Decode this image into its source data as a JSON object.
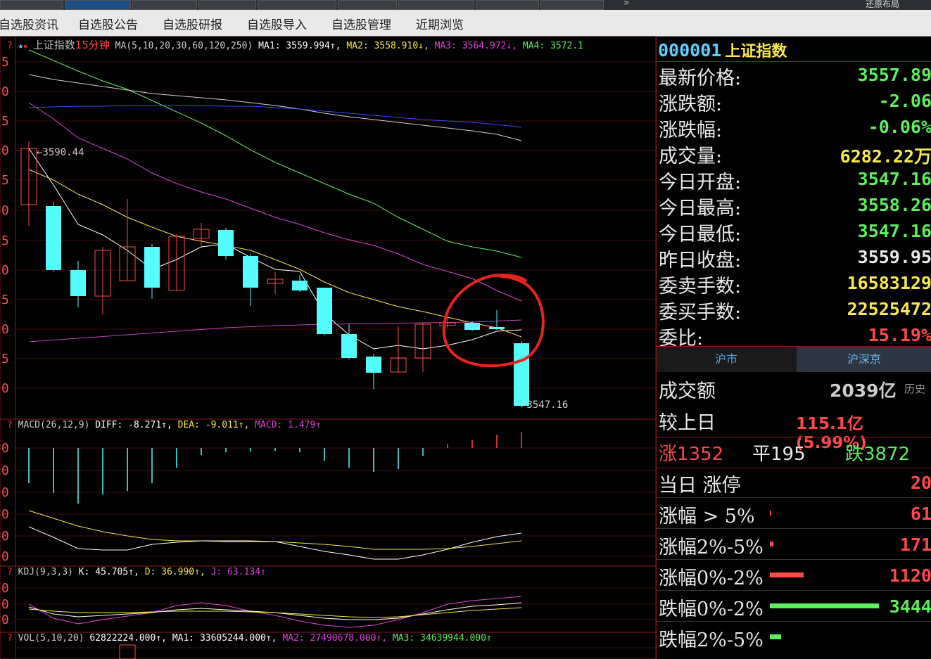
{
  "topbar": {
    "right_label": "还原布局"
  },
  "nav": [
    "自选股资讯",
    "自选股公告",
    "自选股研报",
    "自选股导入",
    "自选股管理",
    "近期浏览"
  ],
  "main_chart": {
    "title": "上证指数",
    "period": "15分钟",
    "ma_params": "MA(5,10,20,30,60,120,250)",
    "ma1": "MA1: 3559.994↑,",
    "ma2": "MA2: 3558.910↓,",
    "ma3": "MA3: 3564.972↓,",
    "ma4": "MA4: 3572.1",
    "high_label": "←3590.44",
    "low_label": "←3547.16",
    "axis_labels": [
      "5",
      "0",
      "5",
      "0",
      "5",
      "0",
      "5",
      "0",
      "5",
      "0",
      "5",
      "0"
    ]
  },
  "macd": {
    "params": "MACD(26,12,9)",
    "diff": "DIFF: -8.271↑,",
    "dea": "DEA: -9.011↑,",
    "macd": "MACD: 1.479↑",
    "axis_labels": [
      "0",
      "0",
      "0",
      "0",
      "0",
      "0"
    ]
  },
  "kdj": {
    "params": "KDJ(9,3,3)",
    "k": "K: 45.705↑,",
    "d": "D: 36.990↑,",
    "j": "J: 63.134↑",
    "axis_labels": [
      "0",
      "0",
      "0"
    ]
  },
  "vol": {
    "params": "VOL(5,10,20)",
    "vol": "62822224.000↑,",
    "ma1": "MA1: 33605244.000↑,",
    "ma2": "MA2: 27490678.000↑,",
    "ma3": "MA3: 34639944.000↑"
  },
  "quote": {
    "code": "000001",
    "name": "上证指数",
    "rows": [
      {
        "label": "最新价格:",
        "value": "3557.89",
        "color": "green"
      },
      {
        "label": "涨跌额:",
        "value": "-2.06",
        "color": "green"
      },
      {
        "label": "涨跌幅:",
        "value": "-0.06%",
        "color": "green"
      },
      {
        "label": "成交量:",
        "value": "6282.22万",
        "color": "yellow"
      },
      {
        "label": "今日开盘:",
        "value": "3547.16",
        "color": "green"
      },
      {
        "label": "今日最高:",
        "value": "3558.26",
        "color": "green"
      },
      {
        "label": "今日最低:",
        "value": "3547.16",
        "color": "green"
      },
      {
        "label": "昨日收盘:",
        "value": "3559.95",
        "color": "white"
      },
      {
        "label": "委卖手数:",
        "value": "16583129",
        "color": "yellow"
      },
      {
        "label": "委买手数:",
        "value": "22525472",
        "color": "yellow"
      },
      {
        "label": "委比:",
        "value": "15.19%",
        "color": "red"
      }
    ]
  },
  "tabs": [
    "沪市",
    "沪深京"
  ],
  "market": {
    "turnover_label": "成交额",
    "turnover_value": "2039亿",
    "turnover_extra": "历史",
    "vs_label": "较上日",
    "vs_value": "115.1亿(5.99%)",
    "up": "涨1352",
    "flat": "平195",
    "down": "跌3872",
    "limit_label": "当日 涨停",
    "limit_value": "20",
    "dist": [
      {
        "label": "涨幅 > 5%",
        "value": "61",
        "color": "red"
      },
      {
        "label": "涨幅2%-5%",
        "value": "171",
        "color": "red"
      },
      {
        "label": "涨幅0%-2%",
        "value": "1120",
        "color": "red"
      },
      {
        "label": "跌幅0%-2%",
        "value": "3444",
        "color": "green"
      },
      {
        "label": "跌幅2%-5%",
        "value": "",
        "color": "green"
      }
    ]
  },
  "colors": {
    "up": "#ff4a4a",
    "down": "#54fcfc",
    "grid": "#8a1a1a"
  }
}
